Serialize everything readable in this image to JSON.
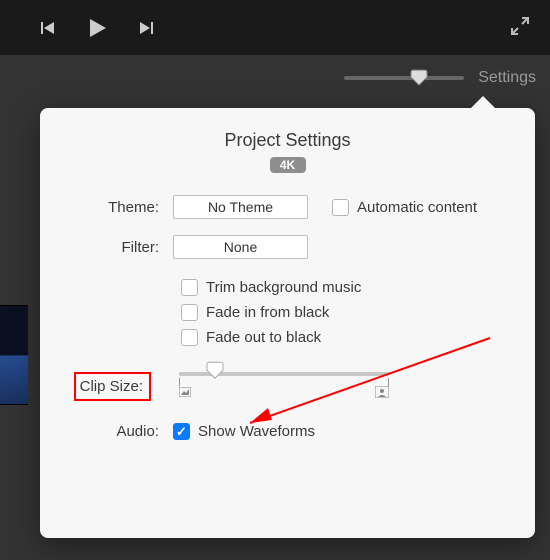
{
  "toolbar": {
    "settings_label": "Settings"
  },
  "popover": {
    "title": "Project Settings",
    "badge": "4K",
    "theme_label": "Theme:",
    "theme_value": "No Theme",
    "auto_content_label": "Automatic content",
    "filter_label": "Filter:",
    "filter_value": "None",
    "trim_label": "Trim background music",
    "fade_in_label": "Fade in from black",
    "fade_out_label": "Fade out to black",
    "clip_size_label": "Clip Size:",
    "audio_label": "Audio:",
    "waveforms_label": "Show Waveforms"
  }
}
